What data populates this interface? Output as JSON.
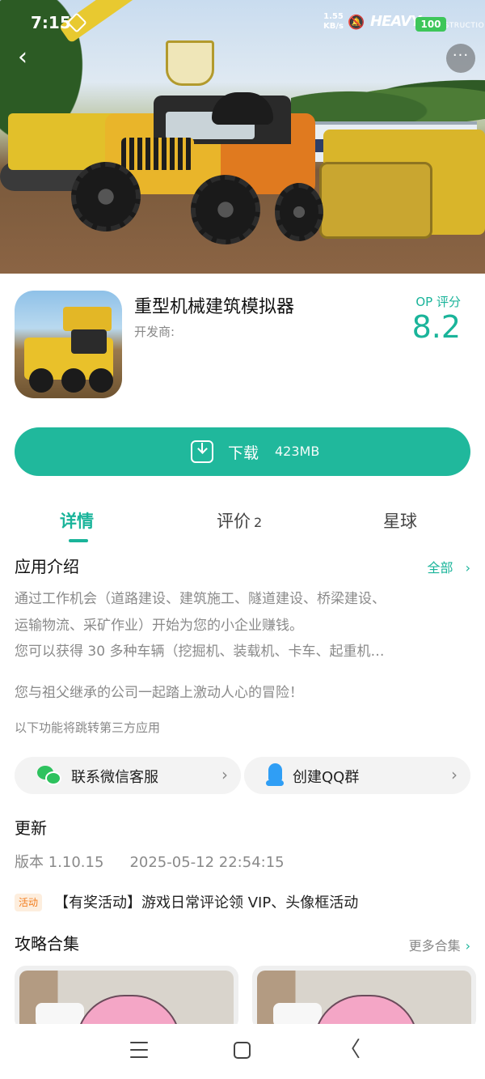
{
  "status_bar": {
    "time": "7:15",
    "net_speed_value": "1.55",
    "net_speed_unit": "KB/s",
    "battery": "100",
    "brand_text": "HEAVY",
    "brand_sub": "CONSTRUCTION"
  },
  "header": {
    "back_icon": "‹",
    "more_icon": "···"
  },
  "app": {
    "title": "重型机械建筑模拟器",
    "developer_label": "开发商:",
    "score_label": "OP 评分",
    "score": "8.2"
  },
  "download": {
    "label": "下载",
    "size": "423MB"
  },
  "tabs": [
    {
      "label": "详情"
    },
    {
      "label": "评价",
      "count": "2"
    },
    {
      "label": "星球"
    }
  ],
  "intro": {
    "title": "应用介绍",
    "all_label": "全部",
    "chevron": "›",
    "lines": [
      "通过工作机会（道路建设、建筑施工、隧道建设、桥梁建设、",
      "运输物流、采矿作业）开始为您的小企业赚钱。",
      "您可以获得 30 多种车辆（挖掘机、装载机、卡车、起重机…",
      "您与祖父继承的公司一起踏上激动人心的冒险！"
    ],
    "third_party_note": "以下功能将跳转第三方应用"
  },
  "contact": {
    "wechat_label": "联系微信客服",
    "qq_label": "创建QQ群",
    "chevron": "›"
  },
  "update": {
    "title": "更新",
    "version": "版本 1.10.15",
    "date": "2025-05-12 22:54:15"
  },
  "activity": {
    "badge": "活动",
    "text": "【有奖活动】游戏日常评论领 VIP、头像框活动"
  },
  "guides": {
    "title": "攻略合集",
    "more_label": "更多合集",
    "chevron": "›"
  },
  "colors": {
    "accent": "#1ab49a",
    "download_button": "#20b89c",
    "battery": "#3dc65a",
    "activity_badge": "#f27d1e"
  }
}
